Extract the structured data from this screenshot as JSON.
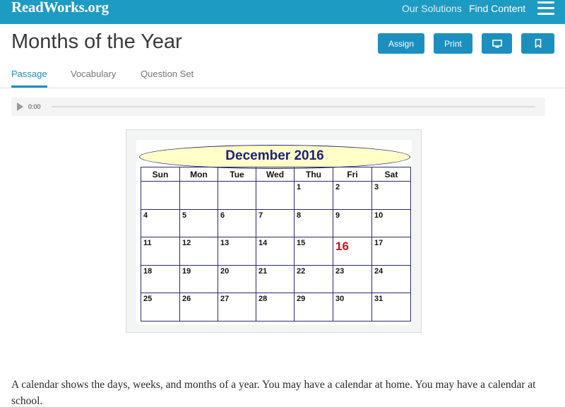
{
  "header": {
    "logo": "ReadWorks.org",
    "nav": {
      "our_solutions": "Our Solutions",
      "find_content": "Find Content"
    }
  },
  "page": {
    "title": "Months of the Year",
    "buttons": {
      "assign": "Assign",
      "print": "Print"
    }
  },
  "tabs": [
    {
      "label": "Passage",
      "active": true
    },
    {
      "label": "Vocabulary",
      "active": false
    },
    {
      "label": "Question Set",
      "active": false
    }
  ],
  "audio": {
    "time": "0:00",
    "progress": 0
  },
  "calendar": {
    "title": "December 2016",
    "days": [
      "Sun",
      "Mon",
      "Tue",
      "Wed",
      "Thu",
      "Fri",
      "Sat"
    ],
    "weeks": [
      [
        "",
        "",
        "",
        "",
        "1",
        "2",
        "3"
      ],
      [
        "4",
        "5",
        "6",
        "7",
        "8",
        "9",
        "10"
      ],
      [
        "11",
        "12",
        "13",
        "14",
        "15",
        "16",
        "17"
      ],
      [
        "18",
        "19",
        "20",
        "21",
        "22",
        "23",
        "24"
      ],
      [
        "25",
        "26",
        "27",
        "28",
        "29",
        "30",
        "31"
      ]
    ],
    "highlight": "16",
    "highlight_color": "#d01010"
  },
  "passage": {
    "text": "A calendar shows the days, weeks, and months of a year. You may have a calendar at home. You may have a calendar at school."
  },
  "colors": {
    "brand": "#1d9bc3",
    "button": "#1d8fbf"
  }
}
